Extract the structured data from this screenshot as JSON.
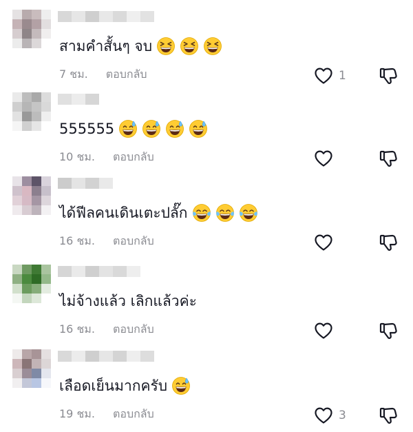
{
  "comments": [
    {
      "text": "สามคำสั้นๆ จบ",
      "time": "7 ชม.",
      "reply_label": "ตอบกลับ",
      "like_count": "1",
      "emojis": [
        "grinning-squinting-face",
        "grinning-squinting-face",
        "grinning-squinting-face"
      ],
      "avatar_colors": [
        "#e5e2e3",
        "#b8abad",
        "#c9bcbd",
        "#eeeeee",
        "#c5b3b6",
        "#9a8a8e",
        "#b3a1a5",
        "#e2dedf",
        "#d6cdcf",
        "#8f8588",
        "#c4babc",
        "#f0eeee",
        "#ececec",
        "#b9b4b6",
        "#dcd8d9",
        "#ffffff"
      ],
      "username_colors": [
        "#d8d8d8",
        "#e6e6e6",
        "#cfcfcf",
        "#e8e8e8",
        "#dadada",
        "#efefef",
        "#e2e2e2"
      ]
    },
    {
      "text": "555555",
      "time": "10 ชม.",
      "reply_label": "ตอบกลับ",
      "like_count": "",
      "emojis": [
        "grinning-face-with-sweat",
        "grinning-face-with-sweat",
        "grinning-face-with-sweat",
        "grinning-face-with-sweat"
      ],
      "avatar_colors": [
        "#eaeaea",
        "#bdbdbd",
        "#a9a9a9",
        "#dcdcdc",
        "#cfcfcf",
        "#b6b6b6",
        "#c5c5c5",
        "#d9d9d9",
        "#e2e2e2",
        "#999999",
        "#bcbcbc",
        "#efefef",
        "#f5f5f5",
        "#d0d0d0",
        "#e6e6e6",
        "#ffffff"
      ],
      "username_colors": [
        "#e0e0e0",
        "#ececec",
        "#d6d6d6"
      ]
    },
    {
      "text": "ได้ฟีลคนเดินเตะปลั๊ก",
      "time": "16 ชม.",
      "reply_label": "ตอบกลับ",
      "like_count": "",
      "emojis": [
        "face-with-tears-of-joy",
        "face-with-tears-of-joy",
        "face-with-tears-of-joy"
      ],
      "avatar_colors": [
        "#e8e3e8",
        "#9d8ea0",
        "#5d5468",
        "#d9d3dc",
        "#cfc2cc",
        "#d9b8c2",
        "#8c7f8e",
        "#c7c0cb",
        "#e1d1d8",
        "#d6bac5",
        "#a596a4",
        "#ddd6dc",
        "#efeaed",
        "#d8ccd2",
        "#bdb3bb",
        "#f3f1f3"
      ],
      "username_colors": [
        "#cccccc",
        "#e4e4e4",
        "#d2d2d2",
        "#e9e9e9"
      ]
    },
    {
      "text": "ไม่จ้างแล้ว เลิกแล้วค่ะ",
      "time": "16 ชม.",
      "reply_label": "ตอบกลับ",
      "like_count": "",
      "emojis": [],
      "avatar_colors": [
        "#c9d8c2",
        "#6f9a62",
        "#3f7a34",
        "#a9c49f",
        "#8fb083",
        "#4b8a3e",
        "#2e6b25",
        "#94b98a",
        "#d2e0cc",
        "#6c9c5e",
        "#86ad7a",
        "#e3ece0",
        "#f4f7f3",
        "#c3d6bd",
        "#dde8d9",
        "#ffffff"
      ],
      "username_colors": [
        "#d6d6d6",
        "#eaeaea",
        "#cfcfcf",
        "#e3e3e3",
        "#d9d9d9",
        "#eeeeee"
      ]
    },
    {
      "text": "เลือดเย็นมากครับ",
      "time": "19 ชม.",
      "reply_label": "ตอบกลับ",
      "like_count": "3",
      "emojis": [
        "grinning-face-with-sweat"
      ],
      "avatar_colors": [
        "#eeeaea",
        "#b8a6a8",
        "#a89497",
        "#e5dfe0",
        "#cdb7ba",
        "#8a7577",
        "#c2b4b6",
        "#dcd6d7",
        "#d9cfd1",
        "#9b8d98",
        "#7f8aa6",
        "#e4e6ee",
        "#f1eff0",
        "#c3c7d8",
        "#b8c6e3",
        "#f6f7fb"
      ],
      "username_colors": [
        "#d9d9d9",
        "#ececec",
        "#cfcfcf",
        "#e6e6e6",
        "#d4d4d4",
        "#eeeeee",
        "#dddddd"
      ]
    }
  ],
  "colors": {
    "text": "#161823",
    "meta": "#8a8b91",
    "icon": "#161823"
  }
}
